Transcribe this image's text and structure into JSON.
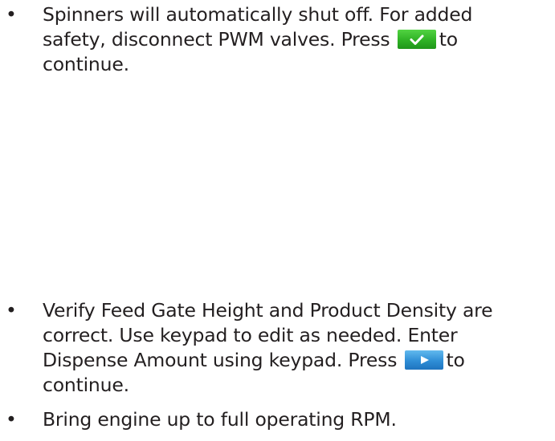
{
  "bullet_symbol": "•",
  "instructions": [
    {
      "line1": "Spinners will automatically shut off.  For added",
      "line2_before": "safety, disconnect PWM valves.  Press",
      "line2_after": "to",
      "line3": "continue.",
      "button_icon": "checkmark-icon",
      "button_color": "#2db224"
    },
    {
      "line1": "Verify Feed Gate Height and Product Density are",
      "line2": "correct.  Use keypad to edit as needed.  Enter",
      "line3_before": "Dispense Amount using keypad.  Press",
      "line3_after": "to",
      "line4": "continue.",
      "button_icon": "play-icon",
      "button_color": "#2b8bd4"
    },
    {
      "line1": "Bring engine up to full operating RPM."
    }
  ]
}
